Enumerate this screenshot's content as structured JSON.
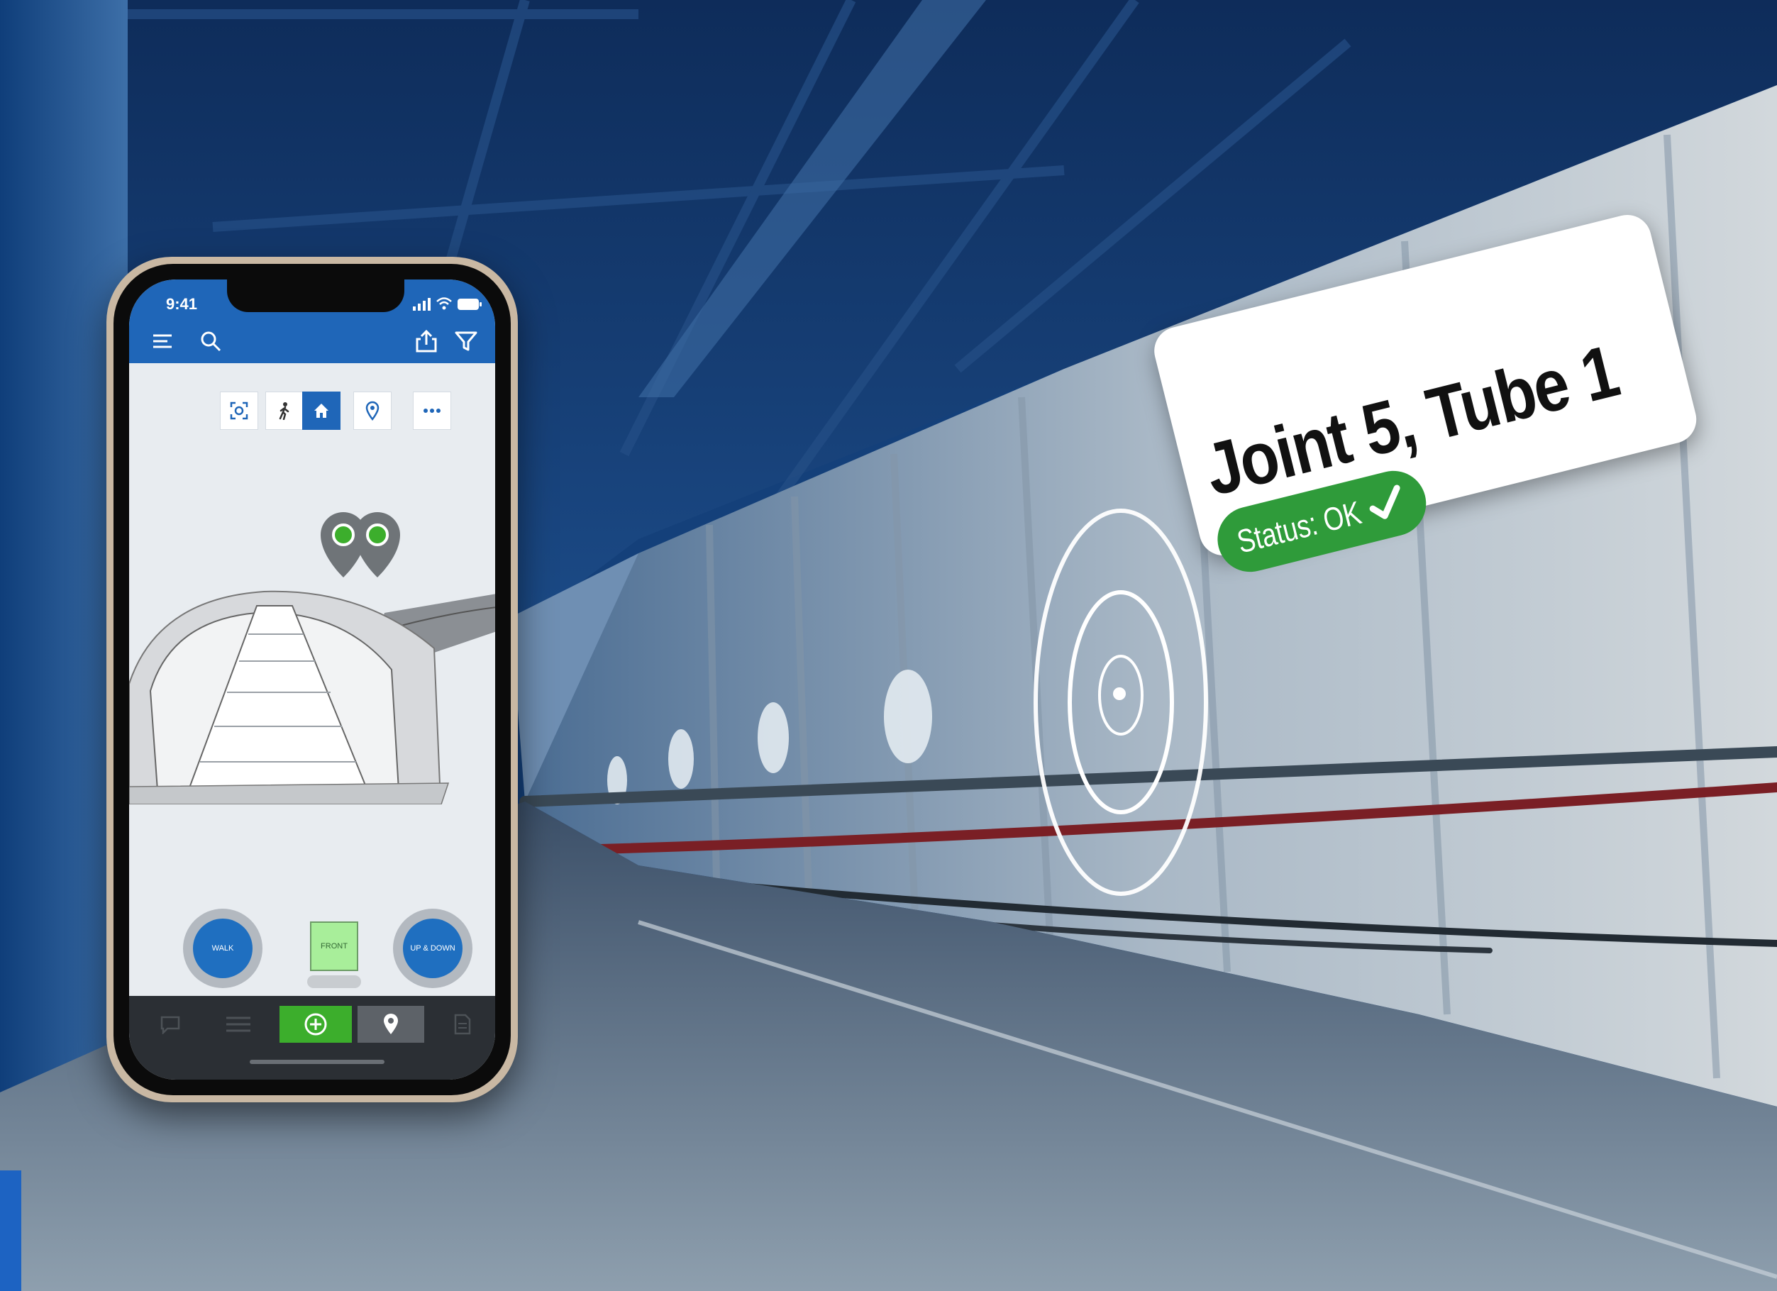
{
  "ar_label": {
    "title": "Joint 5, Tube 1",
    "status_text": "Status: OK",
    "status_color": "#2f9b3a"
  },
  "phone": {
    "status_bar": {
      "time": "9:41"
    },
    "header": {
      "accent_color": "#1f66b8",
      "left_icons": [
        "menu-icon",
        "search-icon"
      ],
      "right_icons": [
        "share-icon",
        "filter-icon"
      ]
    },
    "toolbar": {
      "buttons": [
        "scan-icon",
        "walk-icon",
        "home-icon",
        "location-pin-icon",
        "more-icon"
      ],
      "active": "home-icon"
    },
    "view_controls": {
      "walk_label": "WALK",
      "front_label": "FRONT",
      "up_down_label": "UP & DOWN"
    },
    "tabbar": {
      "items": [
        "comment-icon",
        "list-icon",
        "add-icon",
        "map-pin-icon",
        "document-icon"
      ],
      "active": "map-pin-icon",
      "add_color": "#3cae2c"
    }
  }
}
